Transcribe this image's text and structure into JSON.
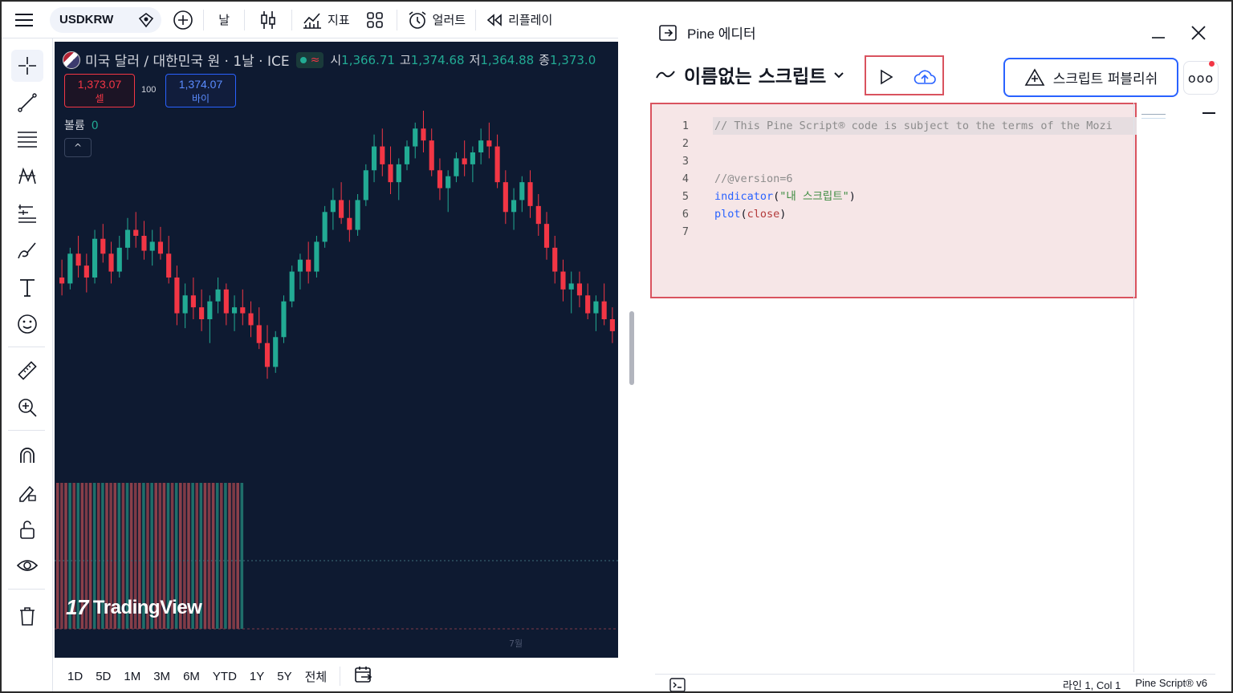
{
  "toolbar": {
    "symbol": "USDKRW",
    "timeframe": "날",
    "indicators_label": "지표",
    "alert_label": "얼러트",
    "replay_label": "리플레이"
  },
  "chart": {
    "title": "미국 달러 / 대한민국 원 · 1날 · ICE",
    "ohlc": [
      {
        "key": "시",
        "value": "1,366.71"
      },
      {
        "key": "고",
        "value": "1,374.68"
      },
      {
        "key": "저",
        "value": "1,364.88"
      },
      {
        "key": "종",
        "value": "1,373.0"
      }
    ],
    "sell_price": "1,373.07",
    "sell_label": "셀",
    "buy_price": "1,374.07",
    "buy_label": "바이",
    "spread": "100",
    "volume_label": "볼륨",
    "volume_value": "0",
    "watermark": "TradingView",
    "axis_tick": "7월",
    "colors": {
      "up": "#22ab94",
      "down": "#f23645",
      "background": "#0e1a31"
    }
  },
  "chart_data": {
    "type": "candlestick",
    "series": [
      {
        "values": [
          [
            1352,
            1358,
            1346,
            1350
          ],
          [
            1350,
            1362,
            1348,
            1360
          ],
          [
            1360,
            1366,
            1352,
            1356
          ],
          [
            1356,
            1360,
            1347,
            1352
          ],
          [
            1352,
            1368,
            1350,
            1365
          ],
          [
            1365,
            1370,
            1357,
            1360
          ],
          [
            1360,
            1364,
            1350,
            1354
          ],
          [
            1354,
            1366,
            1352,
            1362
          ],
          [
            1362,
            1372,
            1358,
            1368
          ],
          [
            1368,
            1374,
            1362,
            1366
          ],
          [
            1366,
            1371,
            1358,
            1361
          ],
          [
            1361,
            1368,
            1356,
            1364
          ],
          [
            1364,
            1369,
            1358,
            1360
          ],
          [
            1360,
            1366,
            1350,
            1352
          ],
          [
            1352,
            1356,
            1336,
            1340
          ],
          [
            1340,
            1350,
            1335,
            1346
          ],
          [
            1346,
            1352,
            1338,
            1342
          ],
          [
            1342,
            1348,
            1334,
            1338
          ],
          [
            1338,
            1346,
            1330,
            1344
          ],
          [
            1344,
            1352,
            1340,
            1348
          ],
          [
            1348,
            1350,
            1336,
            1340
          ],
          [
            1340,
            1346,
            1334,
            1342
          ],
          [
            1342,
            1348,
            1336,
            1340
          ],
          [
            1340,
            1344,
            1332,
            1336
          ],
          [
            1336,
            1342,
            1328,
            1330
          ],
          [
            1330,
            1336,
            1318,
            1322
          ],
          [
            1322,
            1334,
            1320,
            1332
          ],
          [
            1332,
            1346,
            1330,
            1344
          ],
          [
            1344,
            1356,
            1342,
            1354
          ],
          [
            1354,
            1360,
            1348,
            1358
          ],
          [
            1358,
            1364,
            1350,
            1354
          ],
          [
            1354,
            1366,
            1352,
            1364
          ],
          [
            1364,
            1376,
            1362,
            1374
          ],
          [
            1374,
            1382,
            1368,
            1378
          ],
          [
            1378,
            1384,
            1370,
            1372
          ],
          [
            1372,
            1378,
            1364,
            1368
          ],
          [
            1368,
            1380,
            1366,
            1378
          ],
          [
            1378,
            1390,
            1376,
            1388
          ],
          [
            1388,
            1400,
            1384,
            1396
          ],
          [
            1396,
            1402,
            1386,
            1390
          ],
          [
            1390,
            1396,
            1380,
            1384
          ],
          [
            1384,
            1392,
            1378,
            1390
          ],
          [
            1390,
            1398,
            1388,
            1396
          ],
          [
            1396,
            1404,
            1392,
            1402
          ],
          [
            1402,
            1408,
            1394,
            1398
          ],
          [
            1398,
            1402,
            1386,
            1388
          ],
          [
            1388,
            1392,
            1378,
            1382
          ],
          [
            1382,
            1388,
            1374,
            1386
          ],
          [
            1386,
            1394,
            1384,
            1392
          ],
          [
            1392,
            1398,
            1386,
            1390
          ],
          [
            1390,
            1396,
            1384,
            1394
          ],
          [
            1394,
            1402,
            1390,
            1398
          ],
          [
            1398,
            1404,
            1392,
            1396
          ],
          [
            1396,
            1400,
            1382,
            1384
          ],
          [
            1384,
            1388,
            1370,
            1374
          ],
          [
            1374,
            1382,
            1368,
            1378
          ],
          [
            1378,
            1386,
            1374,
            1384
          ],
          [
            1384,
            1388,
            1372,
            1376
          ],
          [
            1376,
            1380,
            1366,
            1370
          ],
          [
            1370,
            1374,
            1358,
            1362
          ],
          [
            1362,
            1366,
            1350,
            1354
          ],
          [
            1354,
            1358,
            1344,
            1348
          ],
          [
            1348,
            1354,
            1340,
            1350
          ],
          [
            1350,
            1354,
            1342,
            1346
          ],
          [
            1346,
            1350,
            1338,
            1340
          ],
          [
            1340,
            1346,
            1334,
            1344
          ],
          [
            1344,
            1350,
            1336,
            1338
          ],
          [
            1338,
            1342,
            1330,
            1334
          ]
        ]
      }
    ]
  },
  "range": [
    "1D",
    "5D",
    "1M",
    "3M",
    "6M",
    "YTD",
    "1Y",
    "5Y",
    "전체"
  ],
  "pine": {
    "panel_title": "Pine 에디터",
    "script_name": "이름없는 스크립트",
    "publish_label": "스크립트 퍼블리쉬",
    "more_label": "ooo",
    "code": [
      {
        "n": "1",
        "parts": [
          {
            "t": "// This Pine Script® code is subject to the terms of the Mozi",
            "c": "c-comment"
          }
        ]
      },
      {
        "n": "2",
        "parts": []
      },
      {
        "n": "3",
        "parts": []
      },
      {
        "n": "4",
        "parts": [
          {
            "t": "//@version=6",
            "c": "c-comment"
          }
        ]
      },
      {
        "n": "5",
        "parts": [
          {
            "t": "indicator",
            "c": "c-func"
          },
          {
            "t": "(",
            "c": "c-punc"
          },
          {
            "t": "\"내 스크립트\"",
            "c": "c-str"
          },
          {
            "t": ")",
            "c": "c-punc"
          }
        ]
      },
      {
        "n": "6",
        "parts": [
          {
            "t": "plot",
            "c": "c-func"
          },
          {
            "t": "(",
            "c": "c-punc"
          },
          {
            "t": "close",
            "c": "c-var"
          },
          {
            "t": ")",
            "c": "c-punc"
          }
        ]
      },
      {
        "n": "7",
        "parts": []
      }
    ],
    "status_position": "라인 1, Col 1",
    "status_version": "Pine Script® v6"
  }
}
